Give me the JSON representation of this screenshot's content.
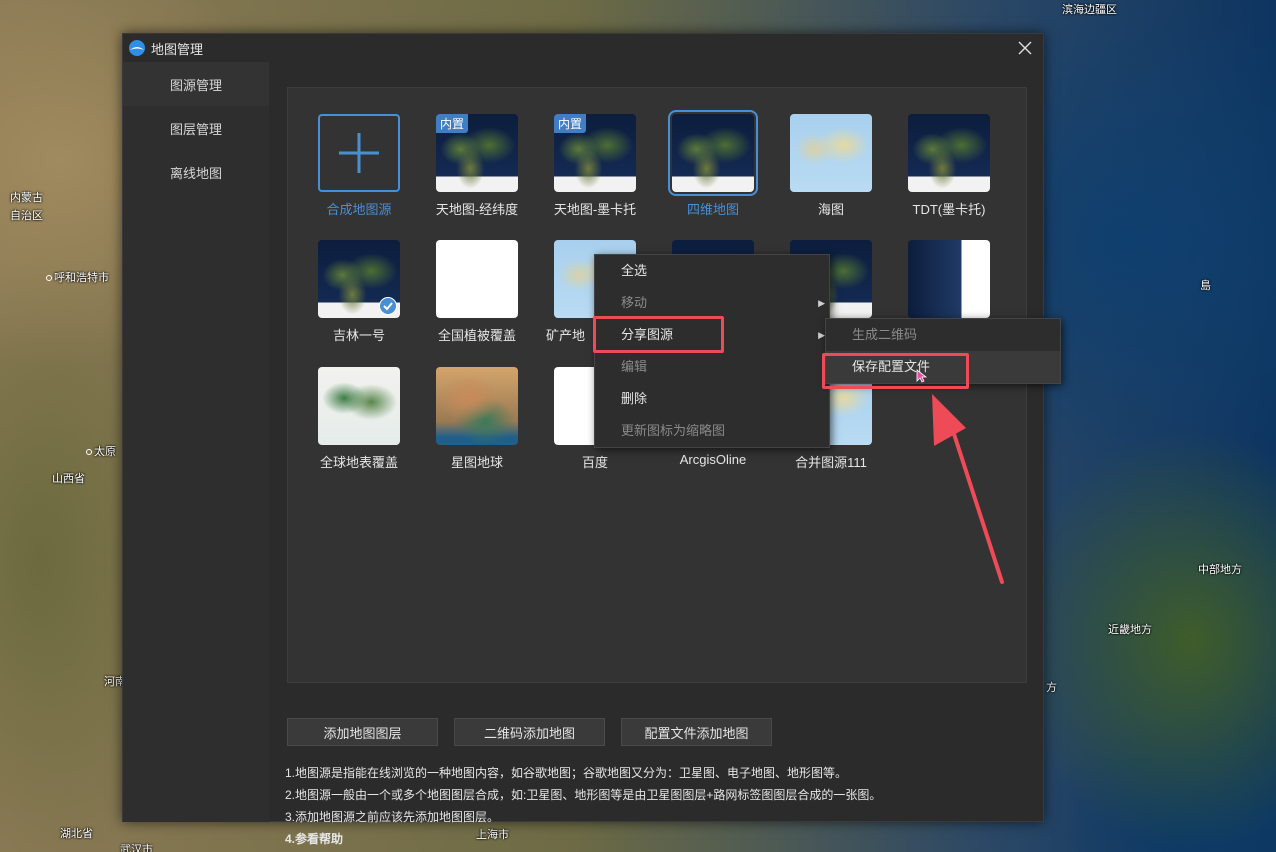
{
  "map": {
    "labels": [
      {
        "text": "滨海边疆区",
        "name": "map-label-primorsky"
      },
      {
        "text": "内蒙古",
        "name": "map-label-neimenggu-1"
      },
      {
        "text": "自治区",
        "name": "map-label-neimenggu-2"
      },
      {
        "text": "呼和浩特市",
        "name": "map-label-hohhot"
      },
      {
        "text": "太原",
        "name": "map-label-taiyuan"
      },
      {
        "text": "山西省",
        "name": "map-label-shanxi"
      },
      {
        "text": "河南",
        "name": "map-label-henan"
      },
      {
        "text": "湖北省",
        "name": "map-label-hubei"
      },
      {
        "text": "武汉市",
        "name": "map-label-wuhan"
      },
      {
        "text": "上海市",
        "name": "map-label-shanghai"
      },
      {
        "text": "中部地方",
        "name": "map-label-chubu"
      },
      {
        "text": "近畿地方",
        "name": "map-label-kinki"
      },
      {
        "text": "方",
        "name": "map-label-fang"
      },
      {
        "text": "島",
        "name": "map-label-island"
      }
    ]
  },
  "dialog": {
    "title": "地图管理",
    "sidebar": [
      {
        "label": "图源管理"
      },
      {
        "label": "图层管理"
      },
      {
        "label": "离线地图"
      }
    ],
    "tiles": [
      {
        "label": "合成地图源"
      },
      {
        "label": "天地图-经纬度",
        "badge": "内置"
      },
      {
        "label": "天地图-墨卡托",
        "badge": "内置"
      },
      {
        "label": "四维地图"
      },
      {
        "label": "海图"
      },
      {
        "label": "TDT(墨卡托)"
      },
      {
        "label": "吉林一号"
      },
      {
        "label": "全国植被覆盖"
      },
      {
        "label": "矿产地"
      },
      {
        "label": "全球地表覆盖"
      },
      {
        "label": "星图地球"
      },
      {
        "label": "百度"
      },
      {
        "label": "ArcgisOline"
      },
      {
        "label": "合并图源111"
      }
    ],
    "buttons": [
      {
        "label": "添加地图图层"
      },
      {
        "label": "二维码添加地图"
      },
      {
        "label": "配置文件添加地图"
      }
    ],
    "notes": [
      "1.地图源是指能在线浏览的一种地图内容，如谷歌地图；谷歌地图又分为：卫星图、电子地图、地形图等。",
      "2.地图源一般由一个或多个地图图层合成，如:卫星图、地形图等是由卫星图图层+路网标签图图层合成的一张图。",
      "3.添加地图源之前应该先添加地图图层。",
      "4.参看帮助"
    ]
  },
  "context_menu": {
    "items": [
      {
        "label": "全选",
        "enabled": true
      },
      {
        "label": "移动",
        "enabled": false,
        "submenu": true
      },
      {
        "label": "分享图源",
        "enabled": true,
        "submenu": true
      },
      {
        "label": "编辑",
        "enabled": false
      },
      {
        "label": "删除",
        "enabled": true
      },
      {
        "label": "更新图标为缩略图",
        "enabled": false
      }
    ],
    "submenu": [
      {
        "label": "生成二维码",
        "enabled": false
      },
      {
        "label": "保存配置文件",
        "enabled": true
      }
    ]
  },
  "colors": {
    "accent": "#4a8fd4",
    "highlight_red": "#ef4a57",
    "badge_blue": "#3f7ec4"
  }
}
